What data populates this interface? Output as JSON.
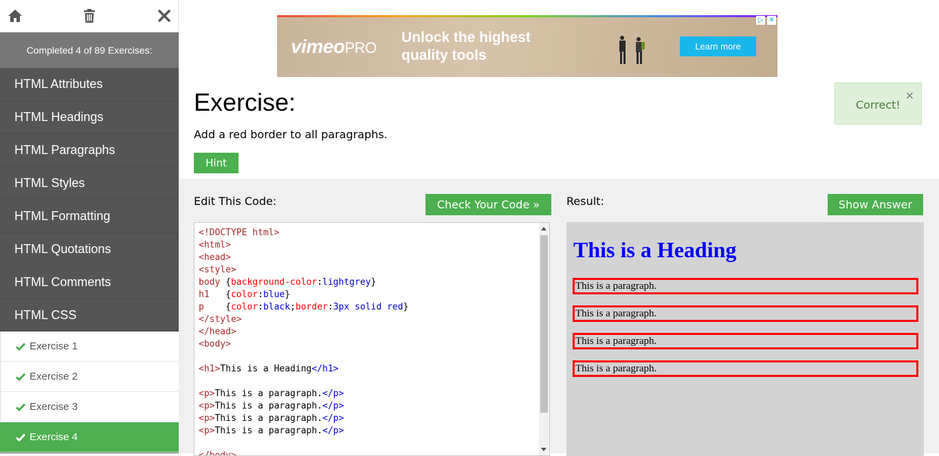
{
  "sidebar": {
    "icons": {
      "home": "home-icon",
      "trash": "trash-icon",
      "close": "close-icon"
    },
    "progress_text": "Completed 4 of 89 Exercises:",
    "nav_items": [
      {
        "label": "HTML Attributes"
      },
      {
        "label": "HTML Headings"
      },
      {
        "label": "HTML Paragraphs"
      },
      {
        "label": "HTML Styles"
      },
      {
        "label": "HTML Formatting"
      },
      {
        "label": "HTML Quotations"
      },
      {
        "label": "HTML Comments"
      },
      {
        "label": "HTML CSS"
      }
    ],
    "exercises": [
      {
        "label": "Exercise 1",
        "completed": true
      },
      {
        "label": "Exercise 2",
        "completed": true
      },
      {
        "label": "Exercise 3",
        "completed": true
      },
      {
        "label": "Exercise 4",
        "completed": true,
        "current": true
      }
    ]
  },
  "ad": {
    "brand": "vimeo",
    "brand_suffix": "PRO",
    "headline": "Unlock the highest quality tools",
    "cta": "Learn more",
    "marks": [
      "▷",
      "✕"
    ]
  },
  "exercise": {
    "title": "Exercise:",
    "description": "Add a red border to all paragraphs.",
    "hint_label": "Hint"
  },
  "toast": {
    "message": "Correct!",
    "close": "×"
  },
  "editor": {
    "label": "Edit This Code:",
    "check_label": "Check Your Code »"
  },
  "result": {
    "label": "Result:",
    "show_answer_label": "Show Answer",
    "heading": "This is a Heading",
    "paragraphs": [
      "This is a paragraph.",
      "This is a paragraph.",
      "This is a paragraph.",
      "This is a paragraph."
    ]
  },
  "code": {
    "doctype": "<!DOCTYPE html>",
    "html_open": "<html>",
    "head_open": "<head>",
    "style_open": "<style>",
    "rule_body": {
      "selector": "body",
      "open": " {",
      "prop": "background-color",
      "colon": ":",
      "value": "lightgrey",
      "close": "}"
    },
    "rule_h1": {
      "selector": "h1",
      "pad": "   {",
      "prop": "color",
      "colon": ":",
      "value": "blue",
      "close": "}"
    },
    "rule_p": {
      "selector": "p",
      "pad": "    {",
      "prop1": "color",
      "colon1": ":",
      "value1": "black",
      "semi": ";",
      "prop2": "border",
      "colon2": ":",
      "value2": "3px solid red",
      "close": "}"
    },
    "style_close": "</style>",
    "head_close": "</head>",
    "body_open": "<body>",
    "h1_open": "<h1>",
    "h1_text": "This is a Heading",
    "h1_close": "</h1>",
    "p_open": "<p>",
    "p_text": "This is a paragraph.",
    "p_close": "</p>",
    "body_close": "</body>"
  },
  "colors": {
    "accent": "#4caf50",
    "sidebar": "#555555",
    "sidebar_progress": "#777777",
    "toast_bg": "#dff0d8"
  }
}
